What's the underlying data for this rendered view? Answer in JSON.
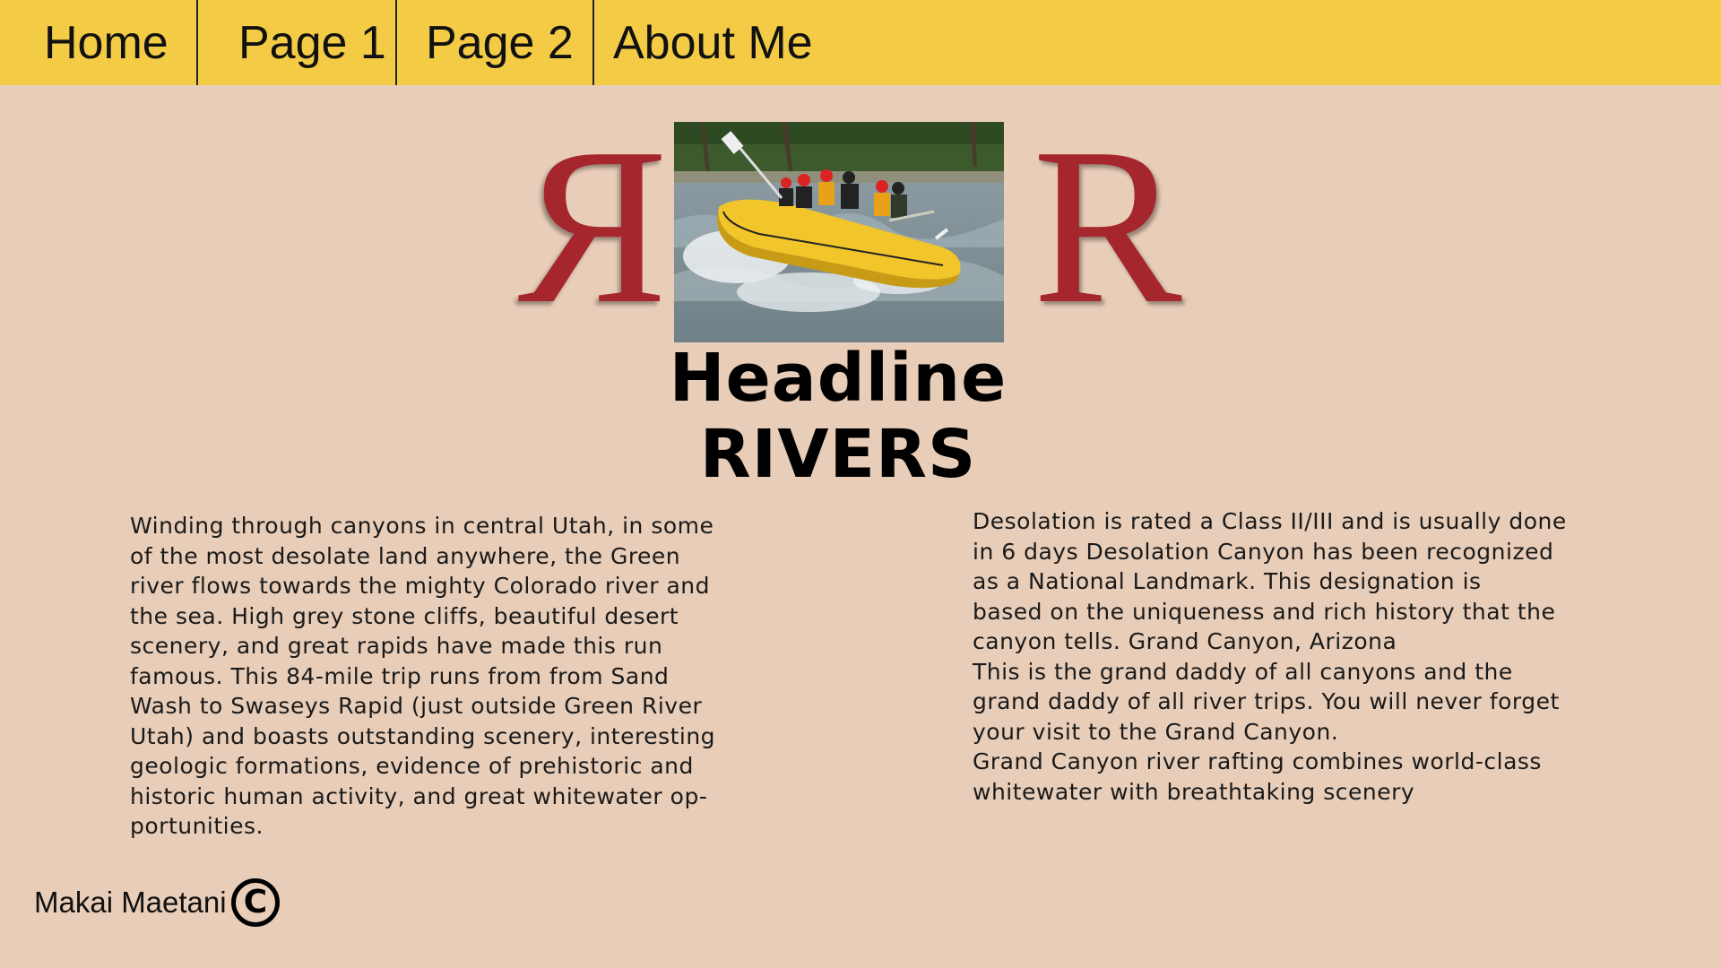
{
  "nav": {
    "items": [
      "Home",
      "Page 1",
      "Page 2",
      "About Me"
    ]
  },
  "logo": {
    "letter": "R",
    "color": "#a5262c"
  },
  "hero_image": {
    "alt": "whitewater-rafting-photo"
  },
  "headline": {
    "line1": "Headline",
    "line2": "RIVERS"
  },
  "content": {
    "left": "Winding through canyons in central Utah, in some of the most desolate land anywhere, the Green river flows towards the mighty Colorado river and the sea. High grey stone cliffs, beautiful desert scenery, and great rapids have made this run famous. This 84-mile trip runs from from Sand Wash to Swaseys Rapid (just outside Green River Utah) and boasts outstanding scenery, interesting geologic formations, evidence of prehistoric and historic human activity, and great whitewater op-portunities.",
    "right_lines": [
      "Desolation is rated a Class II/III and is usually done",
      "in 6 days Desolation Canyon has been recognized",
      "as a National Landmark.  This designation is",
      "based on the uniqueness and rich history that the",
      "canyon tells. Grand Canyon, Arizona",
      "This is the grand daddy of all canyons and the",
      "grand daddy of all river trips. You will never forget",
      "your visit to the Grand Canyon.",
      "Grand Canyon river rafting combines world-class",
      "whitewater with breathtaking scenery"
    ]
  },
  "footer": {
    "author": "Makai Maetani",
    "copyright_symbol": "C"
  },
  "colors": {
    "background": "#e8cdb8",
    "navbar": "#f3cb45",
    "logo": "#a5262c"
  }
}
